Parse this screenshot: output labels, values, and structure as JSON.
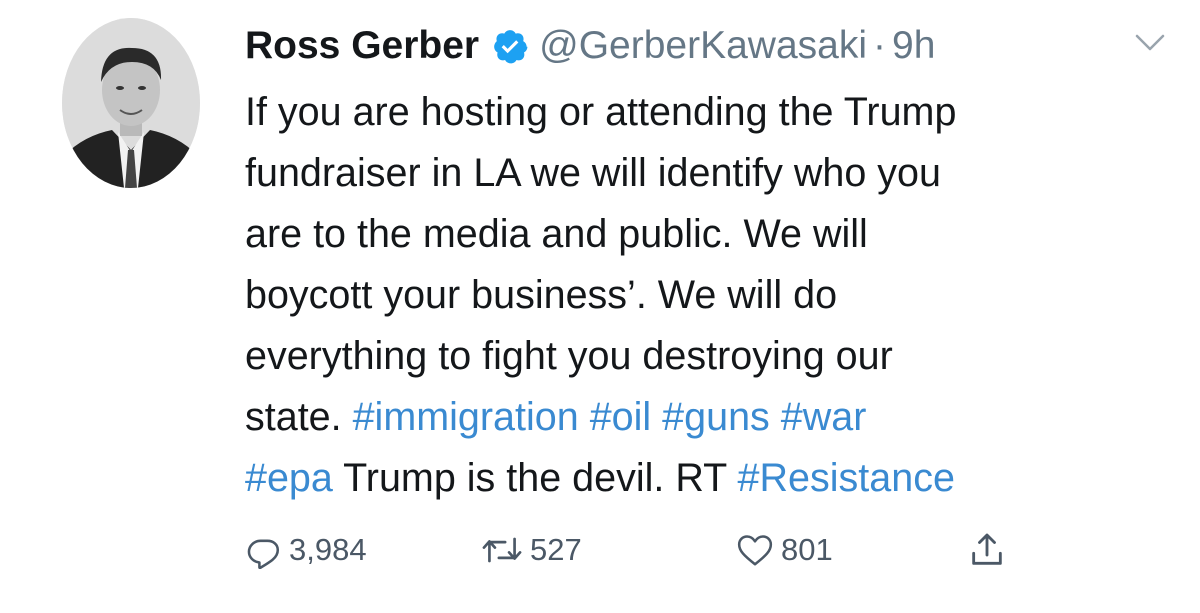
{
  "user": {
    "name": "Ross Gerber",
    "handle": "@GerberKawasaki",
    "separator": "·",
    "time": "9h",
    "verified": true
  },
  "tweet": {
    "lines": [
      [
        {
          "text": "If you are hosting or attending the Trump",
          "tag": false
        }
      ],
      [
        {
          "text": "fundraiser in LA we will identify who you",
          "tag": false
        }
      ],
      [
        {
          "text": "are to the media and public. We will",
          "tag": false
        }
      ],
      [
        {
          "text": "boycott your business’. We will do",
          "tag": false
        }
      ],
      [
        {
          "text": "everything to fight you destroying our",
          "tag": false
        }
      ],
      [
        {
          "text": "state. ",
          "tag": false
        },
        {
          "text": "#immigration",
          "tag": true
        },
        {
          "text": " ",
          "tag": false
        },
        {
          "text": "#oil",
          "tag": true
        },
        {
          "text": " ",
          "tag": false
        },
        {
          "text": "#guns",
          "tag": true
        },
        {
          "text": " ",
          "tag": false
        },
        {
          "text": "#war",
          "tag": true
        }
      ],
      [
        {
          "text": "#epa",
          "tag": true
        },
        {
          "text": " Trump is the devil.  RT ",
          "tag": false
        },
        {
          "text": "#Resistance",
          "tag": true
        }
      ]
    ]
  },
  "actions": {
    "replies": "3,984",
    "retweets": "527",
    "likes": "801"
  },
  "icons": {
    "avatar": "profile-photo",
    "verified": "verified-badge-icon",
    "caret": "chevron-down-icon",
    "reply": "reply-icon",
    "retweet": "retweet-icon",
    "like": "heart-icon",
    "share": "share-icon"
  },
  "colors": {
    "text": "#14171a",
    "muted": "#657786",
    "hashtag": "#3a8ad1",
    "verified": "#1da1f2"
  }
}
